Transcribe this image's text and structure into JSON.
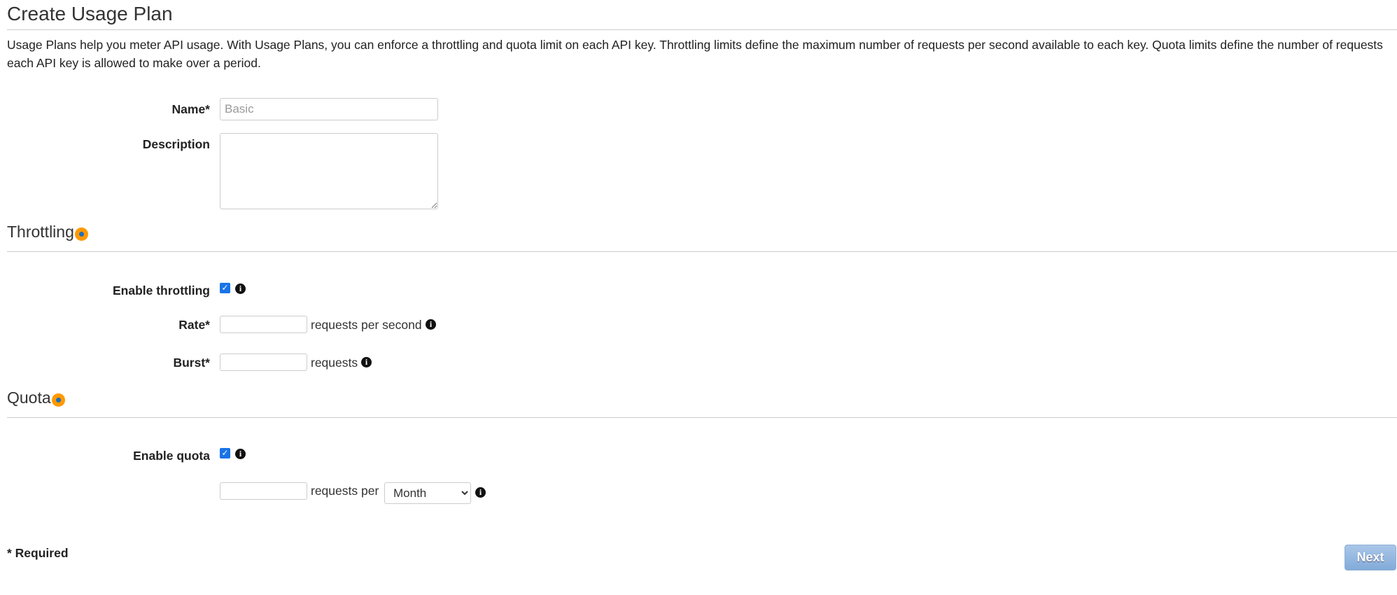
{
  "page": {
    "title": "Create Usage Plan",
    "intro": "Usage Plans help you meter API usage. With Usage Plans, you can enforce a throttling and quota limit on each API key. Throttling limits define the maximum number of requests per second available to each key. Quota limits define the number of requests each API key is allowed to make over a period."
  },
  "form": {
    "name_label": "Name*",
    "name_placeholder": "Basic",
    "name_value": "",
    "description_label": "Description",
    "description_value": ""
  },
  "throttling": {
    "heading": "Throttling",
    "enable_label": "Enable throttling",
    "enabled": true,
    "rate_label": "Rate*",
    "rate_value": "",
    "rate_unit": "requests per second",
    "burst_label": "Burst*",
    "burst_value": "",
    "burst_unit": "requests"
  },
  "quota": {
    "heading": "Quota",
    "enable_label": "Enable quota",
    "enabled": true,
    "value": "",
    "unit": "requests per",
    "period": "Month"
  },
  "footer": {
    "required_note": "* Required",
    "next_label": "Next"
  },
  "colors": {
    "accent": "#1a73e8",
    "help_dot": "#ff9900",
    "next_button": "#82abd9"
  },
  "icons": {
    "info": "info-circle-icon",
    "help": "help-dot-icon",
    "check": "checkbox-checked-icon"
  }
}
